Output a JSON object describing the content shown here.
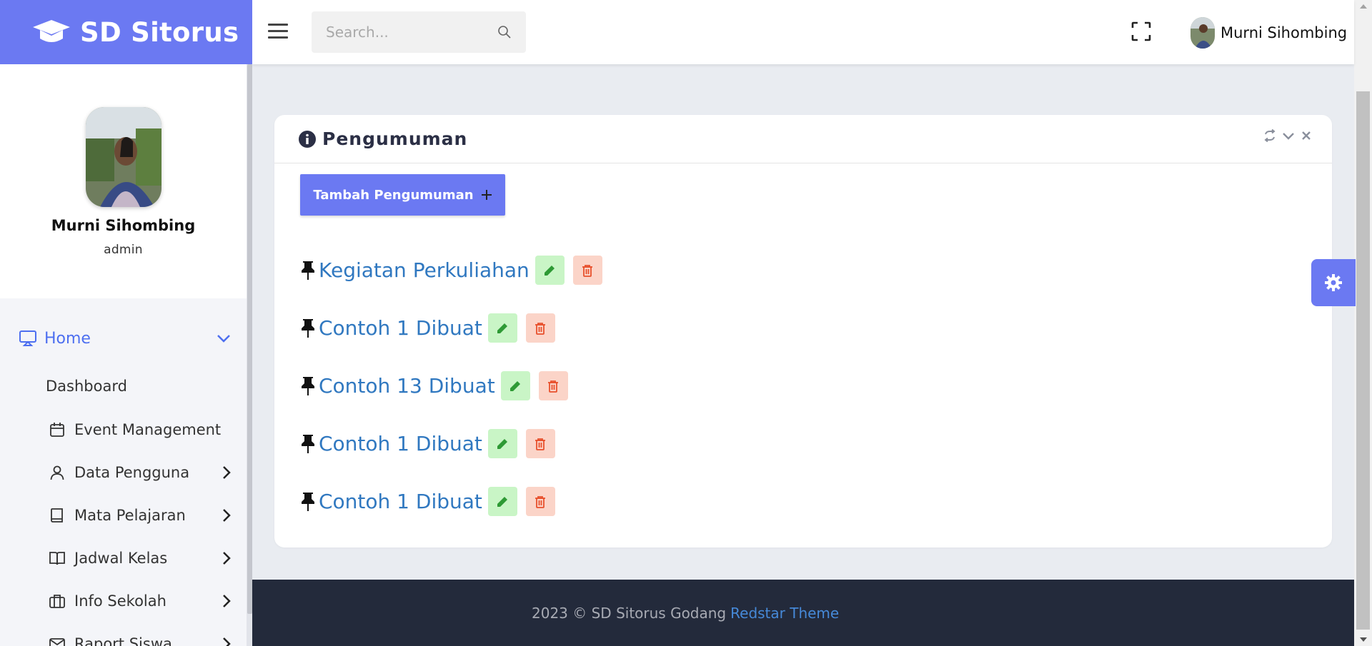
{
  "brand": {
    "name": "SD Sitorus",
    "logo_icon": "graduation-cap-icon"
  },
  "header": {
    "search_placeholder": "Search...",
    "user_name": "Murni Sihombing"
  },
  "sidebar": {
    "profile": {
      "name": "Murni Sihombing",
      "role": "admin"
    },
    "home_label": "Home",
    "dashboard_label": "Dashboard",
    "items": [
      {
        "label": "Event Management",
        "icon": "calendar-icon",
        "has_submenu": false
      },
      {
        "label": "Data Pengguna",
        "icon": "user-icon",
        "has_submenu": true
      },
      {
        "label": "Mata Pelajaran",
        "icon": "book-icon",
        "has_submenu": true
      },
      {
        "label": "Jadwal Kelas",
        "icon": "open-book-icon",
        "has_submenu": true
      },
      {
        "label": "Info Sekolah",
        "icon": "briefcase-icon",
        "has_submenu": true
      },
      {
        "label": "Raport Siswa",
        "icon": "envelope-icon",
        "has_submenu": true
      }
    ]
  },
  "card": {
    "title": "Pengumuman",
    "add_button_label": "Tambah Pengumuman",
    "announcements": [
      {
        "title": "Kegiatan Perkuliahan"
      },
      {
        "title": "Contoh 1 Dibuat"
      },
      {
        "title": "Contoh 13 Dibuat"
      },
      {
        "title": "Contoh 1 Dibuat"
      },
      {
        "title": "Contoh 1 Dibuat"
      }
    ]
  },
  "footer": {
    "text": "2023 © SD Sitorus Godang",
    "link_label": "Redstar Theme"
  },
  "colors": {
    "accent": "#6b79f2",
    "link": "#3078c0",
    "footer_bg": "#232a3b",
    "edit_bg": "#c9f5c6",
    "delete_bg": "#fbd4c8"
  }
}
